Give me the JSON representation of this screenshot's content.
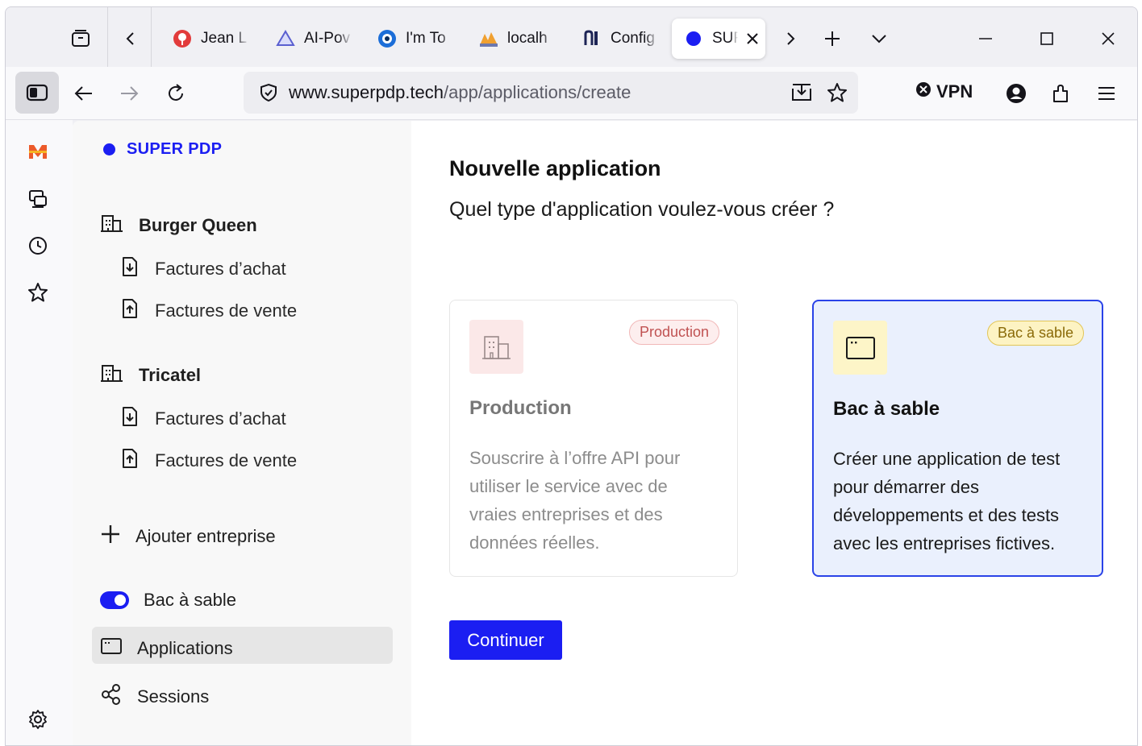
{
  "browser": {
    "tabs": [
      {
        "label": "Jean L",
        "icon": "red-flower-icon"
      },
      {
        "label": "AI-Pov",
        "icon": "triangle-icon"
      },
      {
        "label": "I'm To",
        "icon": "disc-icon"
      },
      {
        "label": "localh",
        "icon": "pma-icon"
      },
      {
        "label": "Config",
        "icon": "n-logo-icon"
      },
      {
        "label": "SUF",
        "icon": "blue-dot-icon",
        "active": true
      }
    ],
    "url_host": "www.superpdp.tech",
    "url_path": "/app/applications/create",
    "vpn_label": "VPN"
  },
  "app": {
    "brand": "SUPER PDP",
    "companies": [
      {
        "name": "Burger Queen",
        "items": [
          "Factures d’achat",
          "Factures de vente"
        ]
      },
      {
        "name": "Tricatel",
        "items": [
          "Factures d’achat",
          "Factures de vente"
        ]
      }
    ],
    "add_company": "Ajouter entreprise",
    "sandbox_toggle_label": "Bac à sable",
    "nav": {
      "applications": "Applications",
      "sessions": "Sessions"
    }
  },
  "main": {
    "title": "Nouvelle application",
    "subtitle": "Quel type d'application voulez-vous créer ?",
    "cards": {
      "production": {
        "badge": "Production",
        "title": "Production",
        "description": "Souscrire à l’offre API pour utiliser le service avec de vraies entreprises et des données réelles."
      },
      "sandbox": {
        "badge": "Bac à sable",
        "title": "Bac à sable",
        "description": "Créer une application de test pour démarrer des développements et des tests avec les entreprises fictives."
      }
    },
    "continue_label": "Continuer"
  },
  "colors": {
    "accent": "#1b1ef2",
    "sandbox_border": "#2a43e8",
    "sandbox_bg": "#eaf0fd",
    "prod_badge": "#c05252",
    "sandbox_badge": "#8a6a08"
  }
}
